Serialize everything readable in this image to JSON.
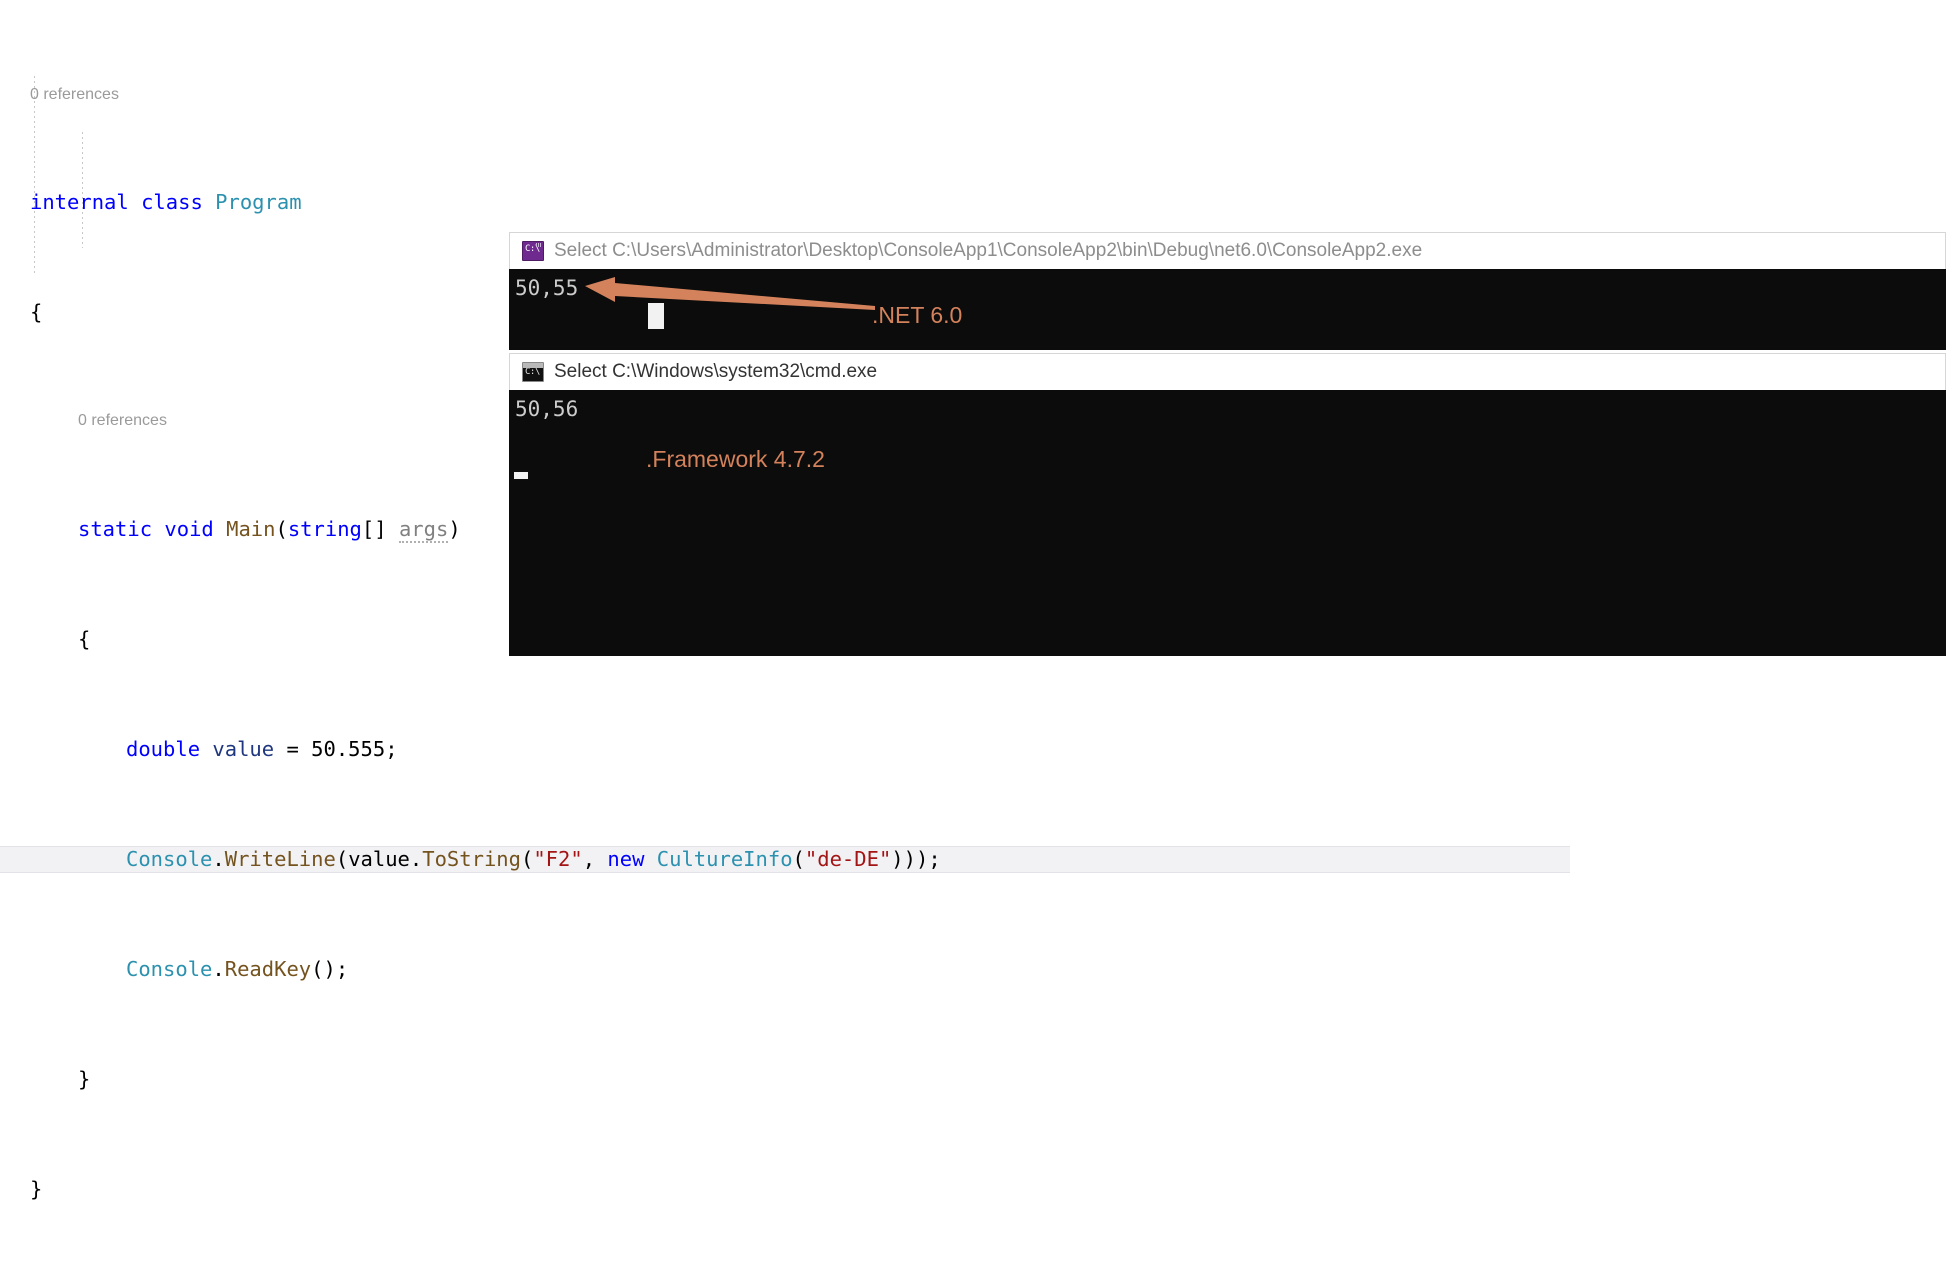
{
  "editor": {
    "lens_class": "0 references",
    "lens_method": "0 references",
    "lines": {
      "class_decl_kw1": "internal",
      "class_decl_kw2": "class",
      "class_decl_name": "Program",
      "open_brace_class": "{",
      "method_kw1": "static",
      "method_kw2": "void",
      "method_name": "Main",
      "method_paren_open": "(",
      "method_param_type": "string",
      "method_param_brackets": "[]",
      "method_param_name": "args",
      "method_paren_close": ")",
      "open_brace_method": "{",
      "decl_kw": "double",
      "decl_name": "value",
      "decl_eq": " = ",
      "decl_value": "50.555",
      "decl_semi": ";",
      "wl_class": "Console",
      "wl_dot": ".",
      "wl_method": "WriteLine",
      "wl_open": "(",
      "wl_var": "value",
      "wl_dot2": ".",
      "wl_tostring": "ToString",
      "wl_open2": "(",
      "wl_fmt": "\"F2\"",
      "wl_comma": ", ",
      "wl_new": "new",
      "wl_culture": "CultureInfo",
      "wl_open3": "(",
      "wl_culture_arg": "\"de-DE\"",
      "wl_close": ")));",
      "rk_class": "Console",
      "rk_dot": ".",
      "rk_method": "ReadKey",
      "rk_rest": "();",
      "close_brace_method": "}",
      "close_brace_class": "}"
    }
  },
  "console1": {
    "title": "Select C:\\Users\\Administrator\\Desktop\\ConsoleApp1\\ConsoleApp2\\bin\\Debug\\net6.0\\ConsoleApp2.exe",
    "icon": "cmd-console-icon",
    "output": "50,55"
  },
  "console2": {
    "title": "Select C:\\Windows\\system32\\cmd.exe",
    "icon": "cmd-console-icon",
    "output": "50,56"
  },
  "annotations": {
    "arrow_label_net6": ".NET 6.0",
    "label_framework": ".Framework 4.7.2",
    "accent_color": "#d4825b"
  }
}
